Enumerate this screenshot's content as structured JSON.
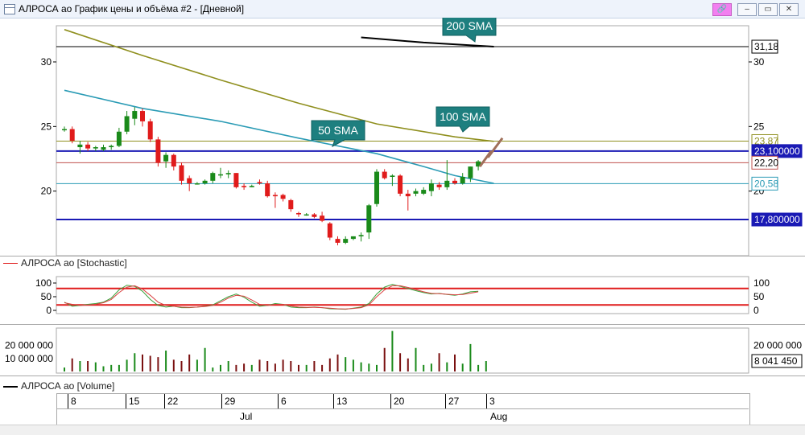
{
  "window": {
    "title": "АЛРОСА ао График цены и объёма #2 - [Дневной]",
    "buttons": {
      "pin": "🔗",
      "minimize": "–",
      "restore": "▭",
      "close": "✕"
    }
  },
  "colors": {
    "bull": "#1a8a1a",
    "bear": "#e01b1b",
    "sma50": "#2a9bb5",
    "sma100": "#8f8f1e",
    "sma200": "#000000",
    "level_blue": "#1a1ab5",
    "stoch_band": "#e01b1b",
    "vol_bear": "#7a1010"
  },
  "price_panel": {
    "y_ticks": [
      "30",
      "25",
      "20"
    ],
    "price_tags": {
      "sma200": "31,18",
      "sma100": "23,87",
      "level_high": "23,100000",
      "last": "22,20",
      "sma50": "20,58",
      "level_low": "17,800000"
    },
    "annotations": {
      "sma200": "200 SMA",
      "sma100": "100 SMA",
      "sma50": "50 SMA"
    }
  },
  "stochastic_panel": {
    "legend": "АЛРОСА ао [Stochastic]",
    "y_ticks": [
      "100",
      "50",
      "0"
    ]
  },
  "volume_panel": {
    "y_ticks_left": [
      "20 000 000",
      "10 000 000"
    ],
    "y_ticks_right": [
      "20 000 000"
    ],
    "last_value": "8 041 450"
  },
  "volume_legend": "АЛРОСА ао [Volume]",
  "x_axis": {
    "dates": [
      "8",
      "15",
      "22",
      "29",
      "6",
      "13",
      "20",
      "27",
      "3"
    ],
    "months": [
      "Jul",
      "Aug"
    ]
  },
  "chart_data": {
    "type": "candlestick",
    "candles": [
      {
        "o": 24.8,
        "h": 25.0,
        "l": 24.6,
        "c": 24.8
      },
      {
        "o": 24.8,
        "h": 25.0,
        "l": 23.7,
        "c": 23.9
      },
      {
        "o": 23.4,
        "h": 23.9,
        "l": 22.9,
        "c": 23.6
      },
      {
        "o": 23.6,
        "h": 23.8,
        "l": 23.1,
        "c": 23.3
      },
      {
        "o": 23.3,
        "h": 23.5,
        "l": 23.1,
        "c": 23.4
      },
      {
        "o": 23.2,
        "h": 23.6,
        "l": 23.1,
        "c": 23.4
      },
      {
        "o": 23.4,
        "h": 23.6,
        "l": 23.2,
        "c": 23.5
      },
      {
        "o": 23.5,
        "h": 24.9,
        "l": 23.4,
        "c": 24.6
      },
      {
        "o": 24.6,
        "h": 26.2,
        "l": 24.4,
        "c": 25.8
      },
      {
        "o": 25.6,
        "h": 26.5,
        "l": 25.1,
        "c": 26.2
      },
      {
        "o": 26.2,
        "h": 26.4,
        "l": 25.0,
        "c": 25.4
      },
      {
        "o": 25.4,
        "h": 25.6,
        "l": 23.8,
        "c": 24.0
      },
      {
        "o": 24.0,
        "h": 24.2,
        "l": 21.9,
        "c": 22.2
      },
      {
        "o": 22.3,
        "h": 23.0,
        "l": 21.8,
        "c": 22.8
      },
      {
        "o": 22.8,
        "h": 22.9,
        "l": 21.6,
        "c": 21.9
      },
      {
        "o": 22.0,
        "h": 22.2,
        "l": 20.5,
        "c": 20.8
      },
      {
        "o": 21.0,
        "h": 21.2,
        "l": 20.0,
        "c": 20.6
      },
      {
        "o": 20.6,
        "h": 20.7,
        "l": 20.5,
        "c": 20.6
      },
      {
        "o": 20.6,
        "h": 20.9,
        "l": 20.5,
        "c": 20.8
      },
      {
        "o": 20.8,
        "h": 21.5,
        "l": 20.6,
        "c": 21.4
      },
      {
        "o": 21.3,
        "h": 21.8,
        "l": 21.0,
        "c": 21.3
      },
      {
        "o": 21.3,
        "h": 21.6,
        "l": 21.0,
        "c": 21.4
      },
      {
        "o": 21.4,
        "h": 21.4,
        "l": 20.2,
        "c": 20.3
      },
      {
        "o": 20.4,
        "h": 20.6,
        "l": 20.1,
        "c": 20.3
      },
      {
        "o": 20.3,
        "h": 20.5,
        "l": 20.3,
        "c": 20.4
      },
      {
        "o": 20.7,
        "h": 20.9,
        "l": 20.5,
        "c": 20.6
      },
      {
        "o": 20.6,
        "h": 20.8,
        "l": 19.5,
        "c": 19.6
      },
      {
        "o": 19.7,
        "h": 19.9,
        "l": 18.7,
        "c": 19.6
      },
      {
        "o": 19.7,
        "h": 19.8,
        "l": 19.2,
        "c": 19.4
      },
      {
        "o": 19.3,
        "h": 19.4,
        "l": 18.4,
        "c": 18.6
      },
      {
        "o": 18.3,
        "h": 18.4,
        "l": 18.0,
        "c": 18.2
      },
      {
        "o": 18.2,
        "h": 18.3,
        "l": 18.1,
        "c": 18.2
      },
      {
        "o": 18.2,
        "h": 18.3,
        "l": 17.9,
        "c": 18.0
      },
      {
        "o": 18.1,
        "h": 18.4,
        "l": 17.6,
        "c": 17.7
      },
      {
        "o": 17.5,
        "h": 17.6,
        "l": 16.2,
        "c": 16.4
      },
      {
        "o": 16.3,
        "h": 16.5,
        "l": 15.8,
        "c": 16.0
      },
      {
        "o": 16.0,
        "h": 16.5,
        "l": 15.9,
        "c": 16.3
      },
      {
        "o": 16.3,
        "h": 16.5,
        "l": 16.2,
        "c": 16.5
      },
      {
        "o": 16.5,
        "h": 16.8,
        "l": 16.1,
        "c": 16.6
      },
      {
        "o": 16.8,
        "h": 19.0,
        "l": 16.3,
        "c": 18.9
      },
      {
        "o": 19.0,
        "h": 21.7,
        "l": 18.8,
        "c": 21.5
      },
      {
        "o": 21.5,
        "h": 21.7,
        "l": 20.9,
        "c": 21.0
      },
      {
        "o": 21.1,
        "h": 21.3,
        "l": 20.4,
        "c": 21.2
      },
      {
        "o": 21.2,
        "h": 21.3,
        "l": 19.6,
        "c": 19.8
      },
      {
        "o": 19.8,
        "h": 20.1,
        "l": 18.5,
        "c": 19.6
      },
      {
        "o": 19.8,
        "h": 20.2,
        "l": 19.6,
        "c": 20.0
      },
      {
        "o": 19.8,
        "h": 20.3,
        "l": 19.7,
        "c": 20.1
      },
      {
        "o": 20.0,
        "h": 20.9,
        "l": 19.6,
        "c": 20.6
      },
      {
        "o": 20.5,
        "h": 20.7,
        "l": 20.1,
        "c": 20.3
      },
      {
        "o": 20.3,
        "h": 22.4,
        "l": 20.1,
        "c": 20.8
      },
      {
        "o": 20.8,
        "h": 21.0,
        "l": 20.5,
        "c": 20.6
      },
      {
        "o": 20.6,
        "h": 21.4,
        "l": 20.5,
        "c": 21.1
      },
      {
        "o": 21.0,
        "h": 21.9,
        "l": 20.7,
        "c": 21.9
      },
      {
        "o": 21.9,
        "h": 22.4,
        "l": 21.6,
        "c": 22.3
      }
    ],
    "sma50": [
      [
        0,
        27.8
      ],
      [
        10,
        26.4
      ],
      [
        20,
        25.4
      ],
      [
        30,
        24.1
      ],
      [
        40,
        22.9
      ],
      [
        46,
        21.9
      ],
      [
        50,
        21.2
      ],
      [
        55,
        20.6
      ]
    ],
    "sma100": [
      [
        0,
        32.5
      ],
      [
        10,
        30.5
      ],
      [
        20,
        28.6
      ],
      [
        30,
        26.8
      ],
      [
        40,
        25.2
      ],
      [
        50,
        24.2
      ],
      [
        55,
        23.85
      ]
    ],
    "sma200": [
      [
        38,
        31.9
      ],
      [
        46,
        31.5
      ],
      [
        55,
        31.18
      ]
    ],
    "levels": {
      "level_high": 23.1,
      "last": 22.2,
      "sma50": 20.58,
      "level_low": 17.8,
      "sma100": 23.87,
      "sma200": 31.18
    },
    "price_ylim": [
      15,
      32.8
    ],
    "stochastic": {
      "k": [
        30,
        15,
        18,
        22,
        25,
        30,
        45,
        75,
        92,
        88,
        70,
        40,
        18,
        12,
        15,
        10,
        10,
        12,
        15,
        20,
        35,
        50,
        60,
        48,
        30,
        15,
        18,
        25,
        22,
        12,
        10,
        10,
        12,
        10,
        6,
        5,
        4,
        8,
        12,
        25,
        60,
        85,
        95,
        88,
        80,
        72,
        65,
        60,
        62,
        58,
        55,
        60,
        68,
        70
      ],
      "d": [
        28,
        22,
        18,
        20,
        22,
        28,
        40,
        65,
        85,
        90,
        78,
        55,
        30,
        18,
        15,
        12,
        11,
        12,
        14,
        18,
        30,
        45,
        55,
        52,
        38,
        22,
        18,
        22,
        22,
        16,
        12,
        11,
        11,
        10,
        8,
        6,
        5,
        7,
        10,
        20,
        50,
        75,
        90,
        90,
        84,
        76,
        68,
        62,
        61,
        59,
        57,
        58,
        63,
        68
      ],
      "bands": [
        80,
        20
      ]
    },
    "volume": {
      "values": [
        0.3,
        1.0,
        0.8,
        0.8,
        0.7,
        0.4,
        0.5,
        0.5,
        0.9,
        1.4,
        1.3,
        1.2,
        1.1,
        1.6,
        0.9,
        0.8,
        1.3,
        0.9,
        1.8,
        0.3,
        0.5,
        0.8,
        0.5,
        0.6,
        0.5,
        0.9,
        0.8,
        0.6,
        0.9,
        0.8,
        0.5,
        0.5,
        0.8,
        0.5,
        1.0,
        1.3,
        1.1,
        0.9,
        0.7,
        0.6,
        0.5,
        1.8,
        3.1,
        1.4,
        1.0,
        1.8,
        0.5,
        0.6,
        1.4,
        0.7,
        1.3,
        0.6,
        2.1,
        0.5,
        0.8
      ],
      "ylim": [
        0,
        3.2
      ]
    }
  }
}
